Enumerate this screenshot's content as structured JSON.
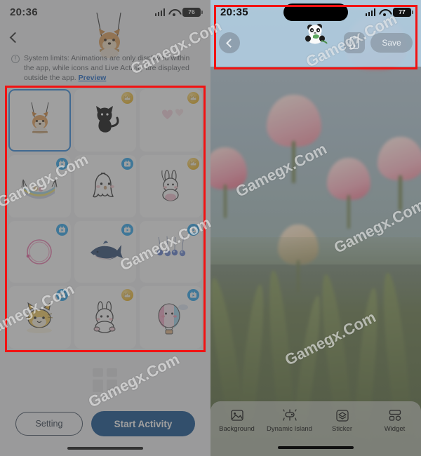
{
  "left_panel": {
    "status_bar": {
      "time": "20:36",
      "battery": "76",
      "signal_icon": "cellular-signal-icon",
      "wifi_icon": "wifi-icon",
      "battery_icon": "battery-icon"
    },
    "back_icon": "chevron-left-icon",
    "hero_sticker": "dog-on-swing-sticker",
    "notice": {
      "info_icon": "info-icon",
      "text": "System limits: Animations are only displayed within the app, while icons and Live Activity are displayed outside the app. ",
      "link": "Preview"
    },
    "grid": {
      "items": [
        {
          "name": "shiba-swing-sticker",
          "badge": "none",
          "selected": true
        },
        {
          "name": "black-cat-sticker",
          "badge": "crown"
        },
        {
          "name": "pink-heart-sticker",
          "badge": "crown"
        },
        {
          "name": "hammock-sticker",
          "badge": "video"
        },
        {
          "name": "white-ghost-sticker",
          "badge": "video"
        },
        {
          "name": "pink-bunny-sticker",
          "badge": "crown"
        },
        {
          "name": "pink-circle-loop-sticker",
          "badge": "video"
        },
        {
          "name": "shark-sticker",
          "badge": "video"
        },
        {
          "name": "hanging-ornaments-sticker",
          "badge": "video"
        },
        {
          "name": "yellow-cat-sticker",
          "badge": "video"
        },
        {
          "name": "white-rabbit-sticker",
          "badge": "crown"
        },
        {
          "name": "hot-air-balloon-sticker",
          "badge": "video"
        }
      ],
      "badge_labels": {
        "crown": "premium-crown-badge",
        "video": "video-play-badge"
      }
    },
    "footer": {
      "setting_label": "Setting",
      "start_label": "Start Activity"
    }
  },
  "right_panel": {
    "status_bar": {
      "time": "20:35",
      "battery": "77",
      "signal_icon": "cellular-signal-icon",
      "wifi_icon": "wifi-icon",
      "battery_icon": "battery-icon"
    },
    "dynamic_island_sticker": "panda-sticker",
    "actions": {
      "back_icon": "chevron-left-icon",
      "device_preview_icon": "phone-preview-icon",
      "save_label": "Save"
    },
    "tabs": [
      {
        "label": "Background",
        "icon": "image-icon"
      },
      {
        "label": "Dynamic Island",
        "icon": "dynamic-island-icon"
      },
      {
        "label": "Sticker",
        "icon": "layers-sticker-icon"
      },
      {
        "label": "Widget",
        "icon": "widget-grid-icon"
      }
    ]
  },
  "annotations": {
    "box_color": "#f21212",
    "boxes": [
      {
        "name": "sticker-grid-highlight"
      },
      {
        "name": "top-bar-highlight"
      }
    ]
  },
  "watermarks": [
    "Gamegx.Com",
    "Gamegx.Com",
    "Gamegx.Com",
    "Gamegx.Com",
    "Gamegx.Com",
    "Gamegx.Com",
    "Gamegx.Com",
    "Gamegx.Com",
    "Gamegx.Com"
  ]
}
